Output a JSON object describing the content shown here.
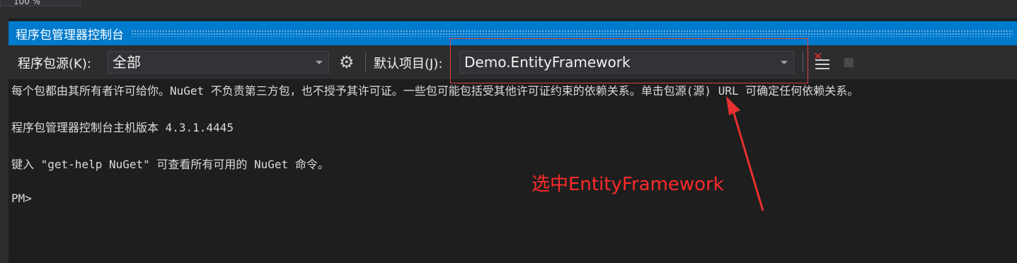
{
  "zoom": {
    "value": "100 %"
  },
  "panel": {
    "title": "程序包管理器控制台"
  },
  "toolbar": {
    "source_label": "程序包源(K):",
    "source_value": "全部",
    "settings_icon": "gear-icon",
    "project_label": "默认项目(J):",
    "project_value": "Demo.EntityFramework",
    "clear_icon": "clear-console-icon",
    "stop_icon": "stop-icon"
  },
  "console": {
    "lines": [
      "每个包都由其所有者许可给你。NuGet 不负责第三方包，也不授予其许可证。一些包可能包括受其他许可证约束的依赖关系。单击包源(源) URL 可确定任何依赖关系。",
      "程序包管理器控制台主机版本 4.3.1.4445",
      "键入 \"get-help NuGet\" 可查看所有可用的 NuGet 命令。",
      "PM>"
    ]
  },
  "annotation": {
    "text": "选中EntityFramework",
    "color": "#ff2a2a"
  },
  "colors": {
    "accent": "#007acc",
    "background": "#1e1e1e"
  }
}
